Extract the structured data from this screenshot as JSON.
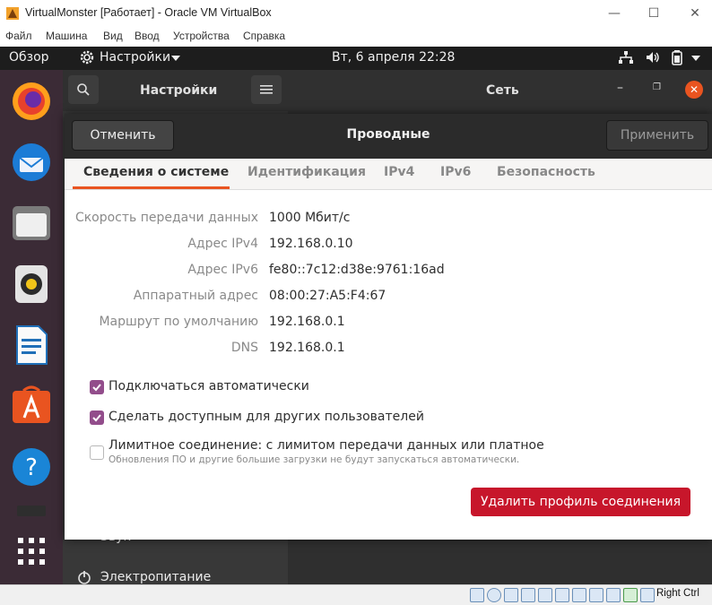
{
  "host_window": {
    "title": "VirtualMonster [Работает] - Oracle VM VirtualBox",
    "menu": [
      "Файл",
      "Машина",
      "Вид",
      "Ввод",
      "Устройства",
      "Справка"
    ],
    "host_key": "Right Ctrl"
  },
  "topbar": {
    "overview": "Обзор",
    "app_menu": "Настройки",
    "clock": "Вт, 6 апреля  22:28"
  },
  "settings": {
    "sidebar_title": "Настройки",
    "panel_title": "Сеть",
    "sidebar_items": [
      "Звук",
      "Электропитание"
    ]
  },
  "dialog": {
    "title": "Проводные",
    "cancel_label": "Отменить",
    "apply_label": "Применить",
    "tabs": [
      "Сведения о системе",
      "Идентификация",
      "IPv4",
      "IPv6",
      "Безопасность"
    ],
    "details": [
      {
        "label": "Скорость передачи данных",
        "value": "1000 Мбит/с"
      },
      {
        "label": "Адрес IPv4",
        "value": "192.168.0.10"
      },
      {
        "label": "Адрес IPv6",
        "value": "fe80::7c12:d38e:9761:16ad"
      },
      {
        "label": "Аппаратный адрес",
        "value": "08:00:27:A5:F4:67"
      },
      {
        "label": "Маршрут по умолчанию",
        "value": "192.168.0.1"
      },
      {
        "label": "DNS",
        "value": "192.168.0.1"
      }
    ],
    "options": [
      {
        "label": "Подключаться автоматически",
        "checked": true
      },
      {
        "label": "Сделать доступным для других пользователей",
        "checked": true
      },
      {
        "label": "Лимитное соединение: с лимитом передачи данных или платное",
        "checked": false,
        "note": "Обновления ПО и другие большие загрузки не будут запускаться автоматически."
      }
    ],
    "delete_label": "Удалить профиль соединения"
  },
  "colors": {
    "accent_orange": "#e95420",
    "checkbox_purple": "#924d8b",
    "destructive_red": "#c7162b",
    "dock_bg": "#3b2b36"
  }
}
